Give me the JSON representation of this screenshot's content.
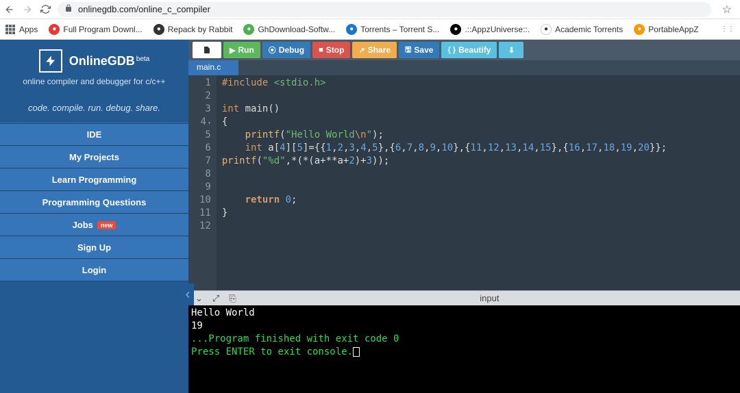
{
  "browser": {
    "url": "onlinegdb.com/online_c_compiler",
    "bookmarks_label": "Apps",
    "bookmarks": [
      {
        "label": "Full Program Downl...",
        "color": "red"
      },
      {
        "label": "Repack by Rabbit",
        "color": "dark"
      },
      {
        "label": "GhDownload-Softw...",
        "color": "green"
      },
      {
        "label": "Torrents – Torrent S...",
        "color": "blue"
      },
      {
        "label": ".::AppzUniverse::.",
        "color": "black"
      },
      {
        "label": "Academic Torrents",
        "color": "white"
      },
      {
        "label": "PortableAppZ",
        "color": "orange"
      }
    ]
  },
  "sidebar": {
    "title": "OnlineGDB",
    "beta": "beta",
    "subtitle": "online compiler and debugger for c/c++",
    "tagline": "code. compile. run. debug. share.",
    "items": [
      {
        "label": "IDE"
      },
      {
        "label": "My Projects"
      },
      {
        "label": "Learn Programming"
      },
      {
        "label": "Programming Questions"
      },
      {
        "label": "Jobs",
        "badge": "new"
      },
      {
        "label": "Sign Up"
      },
      {
        "label": "Login"
      }
    ]
  },
  "toolbar": {
    "run": "Run",
    "debug": "Debug",
    "stop": "Stop",
    "share": "Share",
    "save": "Save",
    "beautify": "Beautify"
  },
  "tabs": [
    {
      "label": "main.c"
    }
  ],
  "editor": {
    "line_numbers": [
      "1",
      "2",
      "3",
      "4",
      "5",
      "6",
      "7",
      "8",
      "9",
      "10",
      "11",
      "12"
    ],
    "code_tokens": [
      [
        {
          "t": "#include ",
          "c": "pp"
        },
        {
          "t": "<stdio.h>",
          "c": "inc"
        }
      ],
      [],
      [
        {
          "t": "int",
          "c": "type"
        },
        {
          "t": " ",
          "c": "txt"
        },
        {
          "t": "main",
          "c": "txt"
        },
        {
          "t": "()",
          "c": "pun"
        }
      ],
      [
        {
          "t": "{",
          "c": "pun"
        }
      ],
      [
        {
          "t": "    ",
          "c": "txt"
        },
        {
          "t": "printf",
          "c": "fn"
        },
        {
          "t": "(",
          "c": "pun"
        },
        {
          "t": "\"Hello World",
          "c": "str"
        },
        {
          "t": "\\n",
          "c": "esc"
        },
        {
          "t": "\"",
          "c": "str"
        },
        {
          "t": ");",
          "c": "pun"
        }
      ],
      [
        {
          "t": "    ",
          "c": "txt"
        },
        {
          "t": "int",
          "c": "type"
        },
        {
          "t": " a[",
          "c": "txt"
        },
        {
          "t": "4",
          "c": "num"
        },
        {
          "t": "][",
          "c": "txt"
        },
        {
          "t": "5",
          "c": "num"
        },
        {
          "t": "]={{",
          "c": "txt"
        },
        {
          "t": "1",
          "c": "num"
        },
        {
          "t": ",",
          "c": "txt"
        },
        {
          "t": "2",
          "c": "num"
        },
        {
          "t": ",",
          "c": "txt"
        },
        {
          "t": "3",
          "c": "num"
        },
        {
          "t": ",",
          "c": "txt"
        },
        {
          "t": "4",
          "c": "num"
        },
        {
          "t": ",",
          "c": "txt"
        },
        {
          "t": "5",
          "c": "num"
        },
        {
          "t": "},{",
          "c": "txt"
        },
        {
          "t": "6",
          "c": "num"
        },
        {
          "t": ",",
          "c": "txt"
        },
        {
          "t": "7",
          "c": "num"
        },
        {
          "t": ",",
          "c": "txt"
        },
        {
          "t": "8",
          "c": "num"
        },
        {
          "t": ",",
          "c": "txt"
        },
        {
          "t": "9",
          "c": "num"
        },
        {
          "t": ",",
          "c": "txt"
        },
        {
          "t": "10",
          "c": "num"
        },
        {
          "t": "},{",
          "c": "txt"
        },
        {
          "t": "11",
          "c": "num"
        },
        {
          "t": ",",
          "c": "txt"
        },
        {
          "t": "12",
          "c": "num"
        },
        {
          "t": ",",
          "c": "txt"
        },
        {
          "t": "13",
          "c": "num"
        },
        {
          "t": ",",
          "c": "txt"
        },
        {
          "t": "14",
          "c": "num"
        },
        {
          "t": ",",
          "c": "txt"
        },
        {
          "t": "15",
          "c": "num"
        },
        {
          "t": "},{",
          "c": "txt"
        },
        {
          "t": "16",
          "c": "num"
        },
        {
          "t": ",",
          "c": "txt"
        },
        {
          "t": "17",
          "c": "num"
        },
        {
          "t": ",",
          "c": "txt"
        },
        {
          "t": "18",
          "c": "num"
        },
        {
          "t": ",",
          "c": "txt"
        },
        {
          "t": "19",
          "c": "num"
        },
        {
          "t": ",",
          "c": "txt"
        },
        {
          "t": "20",
          "c": "num"
        },
        {
          "t": "}};",
          "c": "txt"
        }
      ],
      [
        {
          "t": "printf",
          "c": "fn"
        },
        {
          "t": "(",
          "c": "pun"
        },
        {
          "t": "\"%d\"",
          "c": "str"
        },
        {
          "t": ",*(*(a+**a+",
          "c": "txt"
        },
        {
          "t": "2",
          "c": "num"
        },
        {
          "t": ")+",
          "c": "txt"
        },
        {
          "t": "3",
          "c": "num"
        },
        {
          "t": "));",
          "c": "txt"
        }
      ],
      [],
      [],
      [
        {
          "t": "    ",
          "c": "txt"
        },
        {
          "t": "return",
          "c": "kw"
        },
        {
          "t": " ",
          "c": "txt"
        },
        {
          "t": "0",
          "c": "num"
        },
        {
          "t": ";",
          "c": "pun"
        }
      ],
      [
        {
          "t": "}",
          "c": "pun"
        }
      ],
      []
    ]
  },
  "console_bar": {
    "label": "input"
  },
  "console": {
    "lines": [
      {
        "text": "Hello World",
        "cls": "out"
      },
      {
        "text": "19",
        "cls": "out"
      },
      {
        "text": "",
        "cls": "out"
      },
      {
        "text": "...Program finished with exit code 0",
        "cls": "green"
      },
      {
        "text": "Press ENTER to exit console.",
        "cls": "green",
        "cursor": true
      }
    ]
  }
}
